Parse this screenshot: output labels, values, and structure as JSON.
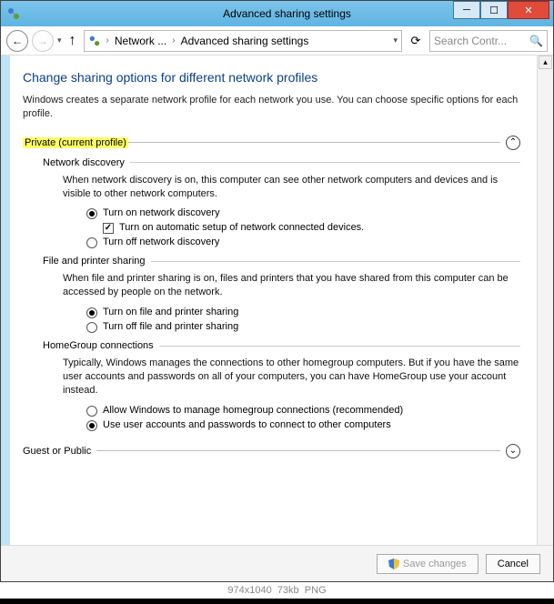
{
  "window": {
    "title": "Advanced sharing settings",
    "minimize_glyph": "─",
    "maximize_glyph": "☐",
    "close_glyph": "✕"
  },
  "nav": {
    "back_glyph": "←",
    "forward_glyph": "→",
    "up_glyph": "↑",
    "drop_glyph": "▾",
    "crumb1": "Network ...",
    "crumb2": "Advanced sharing settings",
    "crumb_sep": "›",
    "refresh_glyph": "⟳",
    "search_placeholder": "Search Contr...",
    "search_glyph": "🔍"
  },
  "page": {
    "heading": "Change sharing options for different network profiles",
    "intro": "Windows creates a separate network profile for each network you use. You can choose specific options for each profile."
  },
  "private_section": {
    "label": "Private (current profile)",
    "expander_glyph": "⌃",
    "network_discovery": {
      "label": "Network discovery",
      "desc": "When network discovery is on, this computer can see other network computers and devices and is visible to other network computers.",
      "opt_on": "Turn on network discovery",
      "opt_auto": "Turn on automatic setup of network connected devices.",
      "opt_off": "Turn off network discovery"
    },
    "file_printer": {
      "label": "File and printer sharing",
      "desc": "When file and printer sharing is on, files and printers that you have shared from this computer can be accessed by people on the network.",
      "opt_on": "Turn on file and printer sharing",
      "opt_off": "Turn off file and printer sharing"
    },
    "homegroup": {
      "label": "HomeGroup connections",
      "desc": "Typically, Windows manages the connections to other homegroup computers. But if you have the same user accounts and passwords on all of your computers, you can have HomeGroup use your account instead.",
      "opt_allow": "Allow Windows to manage homegroup connections (recommended)",
      "opt_use": "Use user accounts and passwords to connect to other computers"
    }
  },
  "guest_section": {
    "label": "Guest or Public",
    "expander_glyph": "⌄"
  },
  "footer": {
    "save": "Save changes",
    "cancel": "Cancel"
  },
  "caption": {
    "dims": "974x1040",
    "size": "73kb",
    "type": "PNG"
  }
}
